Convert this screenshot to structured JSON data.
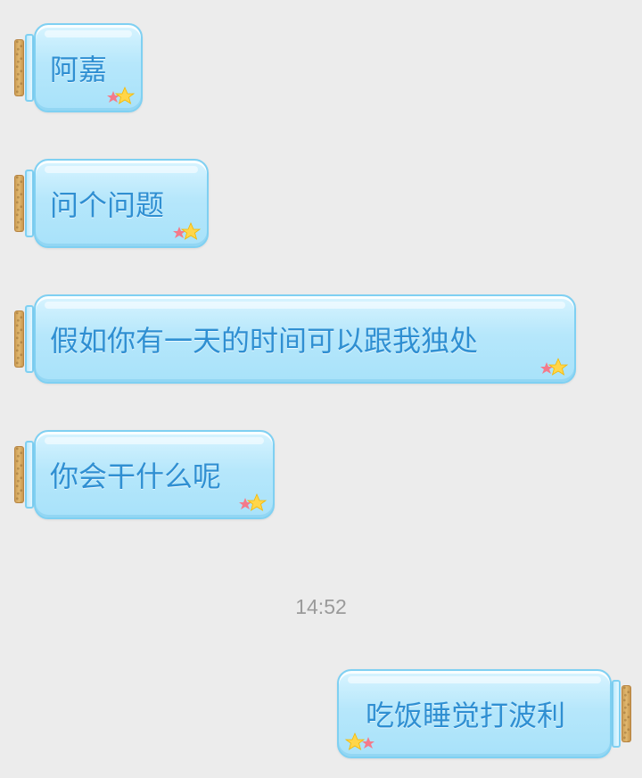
{
  "chat": {
    "incoming_messages": [
      {
        "text": "阿嘉"
      },
      {
        "text": "问个问题"
      },
      {
        "text": "假如你有一天的时间可以跟我独处"
      },
      {
        "text": "你会干什么呢"
      }
    ],
    "timestamp": "14:52",
    "outgoing_messages": [
      {
        "text": "吃饭睡觉打波利"
      }
    ]
  },
  "theme": {
    "background": "#ececec",
    "bubble_fill": "#b6e7fb",
    "bubble_border": "#7fd0f2",
    "text_color": "#2f8fd2",
    "timestamp_color": "#9a9a9a",
    "bubble_style": "glass-bottle-with-cork",
    "decoration_icon": "star-pair-icon"
  }
}
